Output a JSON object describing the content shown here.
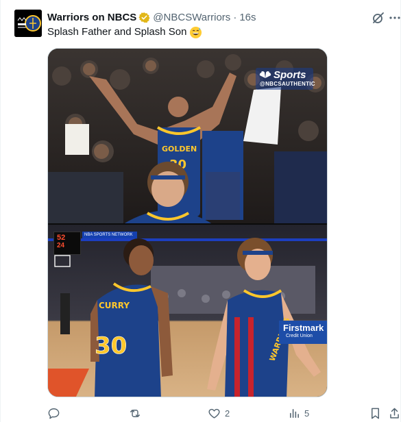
{
  "tweet": {
    "display_name": "Warriors on NBCS",
    "handle": "@NBCSWarriors",
    "separator": "·",
    "timestamp": "16s",
    "text": "Splash Father and Splash Son",
    "emoji": "grinning-sweat-emoji"
  },
  "media": {
    "watermark_top": "Sports",
    "watermark_bottom": "@NBCSAUTHENTIC",
    "scoreboard_line1": "52",
    "scoreboard_line2": "24",
    "arena_banner": "NBA SPORTS NETWORK",
    "sponsor_name": "Firstmark",
    "sponsor_sub": "Credit Union",
    "jersey_top_name": "GOLDEN",
    "jersey_top_number": "30",
    "jersey_curry_name": "CURRY",
    "jersey_curry_number": "30",
    "jersey_right_name": "WARRIORS"
  },
  "actions": {
    "reply_count": "",
    "repost_count": "",
    "like_count": "2",
    "views_count": "5"
  },
  "colors": {
    "text_primary": "#0f1419",
    "text_secondary": "#536471",
    "verified_gold": "#e2b719",
    "warriors_blue": "#1d428a",
    "warriors_gold": "#ffc72c"
  }
}
